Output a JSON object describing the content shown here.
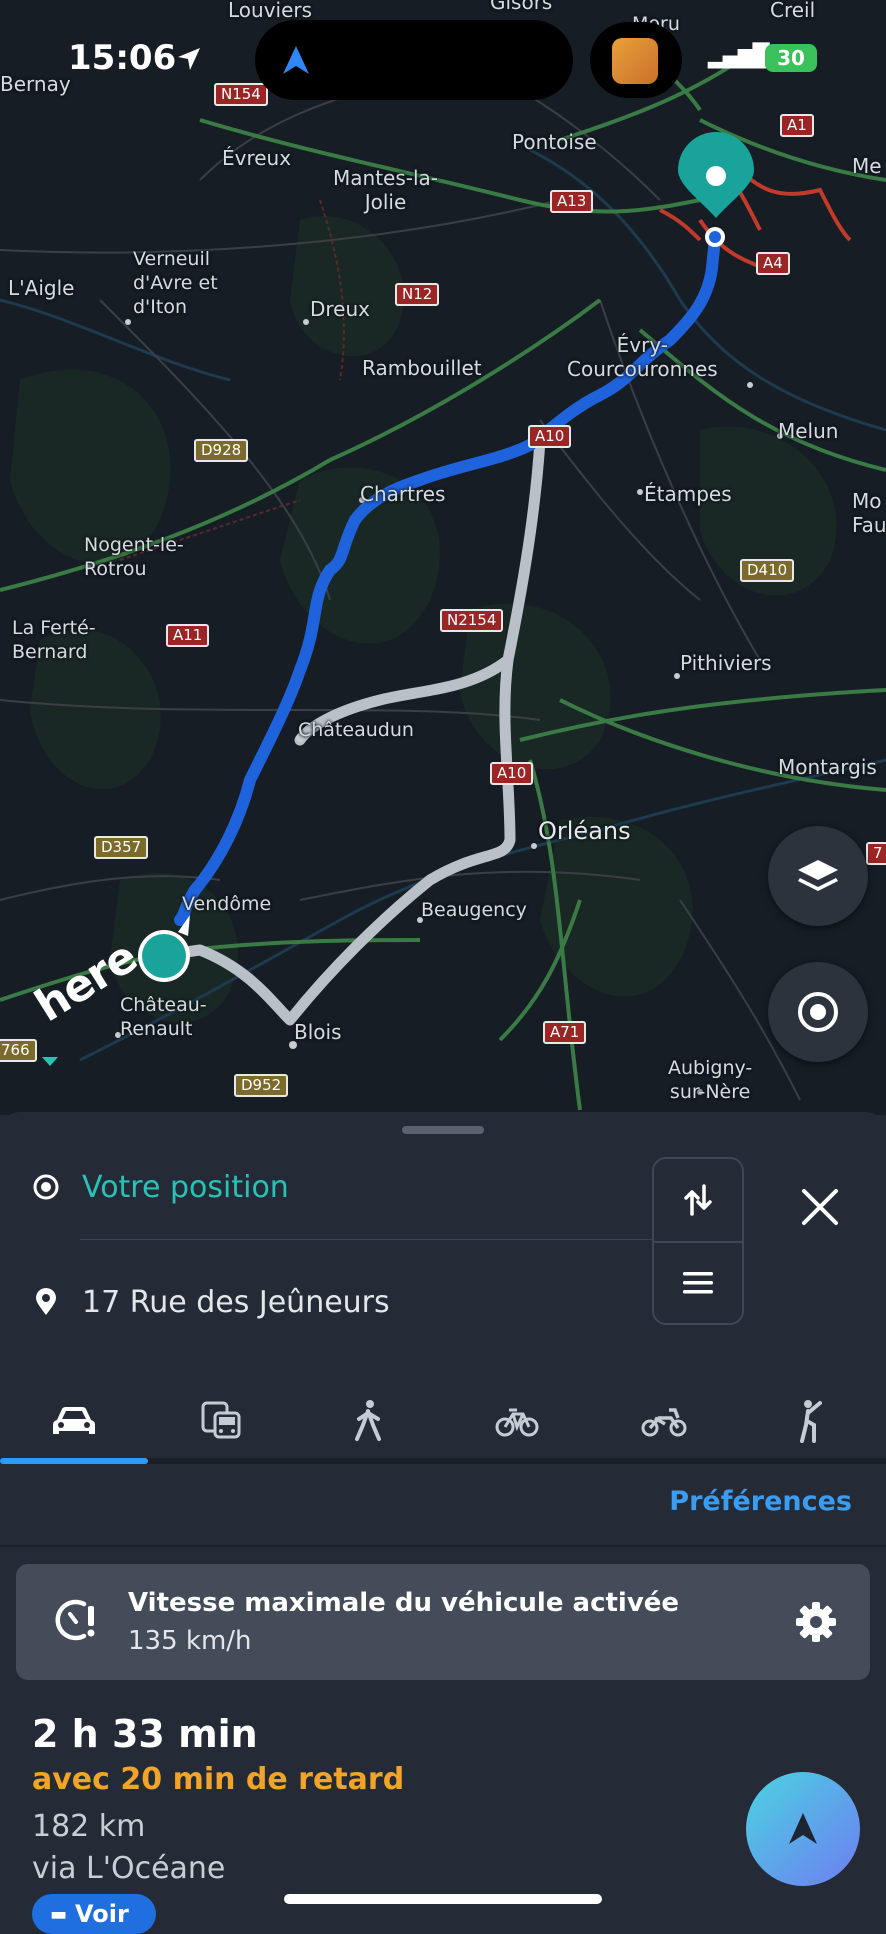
{
  "status_bar": {
    "time": "15:06",
    "battery": "30"
  },
  "map": {
    "places": [
      {
        "id": "louviers",
        "label": "Louviers"
      },
      {
        "id": "gisors",
        "label": "Gisors"
      },
      {
        "id": "moru",
        "label": "Moru"
      },
      {
        "id": "creil",
        "label": "Creil"
      },
      {
        "id": "bernay",
        "label": "Bernay"
      },
      {
        "id": "pontoise",
        "label": "Pontoise"
      },
      {
        "id": "me",
        "label": "Me"
      },
      {
        "id": "evreux",
        "label": "Évreux"
      },
      {
        "id": "mantes",
        "label": "Mantes-la-\nJolie"
      },
      {
        "id": "verneuil",
        "label": "Verneuil\nd'Avre et\nd'Iton"
      },
      {
        "id": "laigle",
        "label": "L'Aigle"
      },
      {
        "id": "dreux",
        "label": "Dreux"
      },
      {
        "id": "evry",
        "label": "Évry-\nCourcouronnes"
      },
      {
        "id": "rambouillet",
        "label": "Rambouillet"
      },
      {
        "id": "melun",
        "label": "Melun"
      },
      {
        "id": "chartres",
        "label": "Chartres"
      },
      {
        "id": "etampes",
        "label": "Étampes"
      },
      {
        "id": "mofa",
        "label": "Mo\nFau"
      },
      {
        "id": "nogent",
        "label": "Nogent-le-\nRotrou"
      },
      {
        "id": "laferte",
        "label": "La Ferté-\nBernard"
      },
      {
        "id": "pithiviers",
        "label": "Pithiviers"
      },
      {
        "id": "chateaudun",
        "label": "Châteaudun"
      },
      {
        "id": "montargis",
        "label": "Montargis"
      },
      {
        "id": "orleans",
        "label": "Orléans"
      },
      {
        "id": "vendome",
        "label": "Vendôme"
      },
      {
        "id": "beaugency",
        "label": "Beaugency"
      },
      {
        "id": "chateaurenault",
        "label": "Château-\nRenault"
      },
      {
        "id": "blois",
        "label": "Blois"
      },
      {
        "id": "aubigny",
        "label": "Aubigny-\nsur-Nère"
      }
    ],
    "roads": [
      {
        "id": "n154",
        "label": "N154"
      },
      {
        "id": "a1",
        "label": "A1"
      },
      {
        "id": "a13",
        "label": "A13"
      },
      {
        "id": "n12",
        "label": "N12"
      },
      {
        "id": "a4",
        "label": "A4"
      },
      {
        "id": "d928",
        "label": "D928"
      },
      {
        "id": "a10a",
        "label": "A10"
      },
      {
        "id": "n2154",
        "label": "N2154"
      },
      {
        "id": "a11",
        "label": "A11"
      },
      {
        "id": "d410",
        "label": "D410"
      },
      {
        "id": "a10b",
        "label": "A10"
      },
      {
        "id": "d357",
        "label": "D357"
      },
      {
        "id": "a71",
        "label": "A71"
      },
      {
        "id": "d952",
        "label": "D952"
      },
      {
        "id": "d766",
        "label": "766"
      },
      {
        "id": "d7x",
        "label": "7"
      }
    ],
    "logo": "here"
  },
  "route_panel": {
    "origin": "Votre position",
    "destination": "17 Rue des Jeûneurs",
    "modes": [
      {
        "name": "car",
        "active": true
      },
      {
        "name": "public-transport",
        "active": false
      },
      {
        "name": "walk",
        "active": false
      },
      {
        "name": "bike",
        "active": false
      },
      {
        "name": "scooter",
        "active": false
      },
      {
        "name": "wheelchair",
        "active": false
      }
    ],
    "preferences_label": "Préférences",
    "alert": {
      "title": "Vitesse maximale du véhicule activée",
      "subtitle": "135 km/h"
    },
    "summary": {
      "duration": "2 h 33 min",
      "delay": "avec 20 min de retard",
      "distance": "182 km",
      "via": "via L'Océane",
      "details_label": "Voir"
    }
  },
  "colors": {
    "accent": "#28c3b6",
    "route_primary": "#1f63dc",
    "route_alt": "#b9c0c8",
    "delay": "#f2a42a",
    "link": "#3a9df2"
  }
}
